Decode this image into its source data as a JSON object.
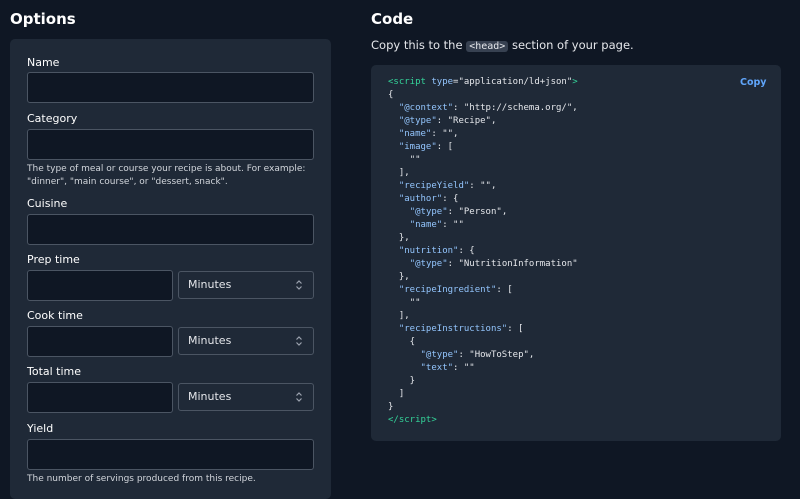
{
  "options": {
    "heading": "Options",
    "fields": {
      "name": {
        "label": "Name",
        "value": ""
      },
      "category": {
        "label": "Category",
        "value": "",
        "help_line1": "The type of meal or course your recipe is about. For example:",
        "help_line2": "\"dinner\", \"main course\", or \"dessert, snack\"."
      },
      "cuisine": {
        "label": "Cuisine",
        "value": ""
      },
      "prep_time": {
        "label": "Prep time",
        "value": "",
        "unit": "Minutes"
      },
      "cook_time": {
        "label": "Cook time",
        "value": "",
        "unit": "Minutes"
      },
      "total_time": {
        "label": "Total time",
        "value": "",
        "unit": "Minutes"
      },
      "yield": {
        "label": "Yield",
        "value": "",
        "help": "The number of servings produced from this recipe."
      }
    }
  },
  "code": {
    "heading": "Code",
    "instruction_before": "Copy this to the ",
    "instruction_tag": "<head>",
    "instruction_after": " section of your page.",
    "copy_label": "Copy",
    "lines": [
      [
        [
          "tag",
          "<script "
        ],
        [
          "attr",
          "type"
        ],
        [
          "punc",
          "="
        ],
        [
          "str",
          "\"application/ld+json\""
        ],
        [
          "tag",
          ">"
        ]
      ],
      [
        [
          "punc",
          "{"
        ]
      ],
      [
        [
          "punc",
          "  "
        ],
        [
          "key",
          "\"@context\""
        ],
        [
          "punc",
          ": "
        ],
        [
          "str",
          "\"http://schema.org/\""
        ],
        [
          "punc",
          ","
        ]
      ],
      [
        [
          "punc",
          "  "
        ],
        [
          "key",
          "\"@type\""
        ],
        [
          "punc",
          ": "
        ],
        [
          "str",
          "\"Recipe\""
        ],
        [
          "punc",
          ","
        ]
      ],
      [
        [
          "punc",
          "  "
        ],
        [
          "key",
          "\"name\""
        ],
        [
          "punc",
          ": "
        ],
        [
          "str",
          "\"\""
        ],
        [
          "punc",
          ","
        ]
      ],
      [
        [
          "punc",
          "  "
        ],
        [
          "key",
          "\"image\""
        ],
        [
          "punc",
          ": ["
        ]
      ],
      [
        [
          "punc",
          "    "
        ],
        [
          "str",
          "\"\""
        ]
      ],
      [
        [
          "punc",
          "  ],"
        ]
      ],
      [
        [
          "punc",
          "  "
        ],
        [
          "key",
          "\"recipeYield\""
        ],
        [
          "punc",
          ": "
        ],
        [
          "str",
          "\"\""
        ],
        [
          "punc",
          ","
        ]
      ],
      [
        [
          "punc",
          "  "
        ],
        [
          "key",
          "\"author\""
        ],
        [
          "punc",
          ": {"
        ]
      ],
      [
        [
          "punc",
          "    "
        ],
        [
          "key",
          "\"@type\""
        ],
        [
          "punc",
          ": "
        ],
        [
          "str",
          "\"Person\""
        ],
        [
          "punc",
          ","
        ]
      ],
      [
        [
          "punc",
          "    "
        ],
        [
          "key",
          "\"name\""
        ],
        [
          "punc",
          ": "
        ],
        [
          "str",
          "\"\""
        ]
      ],
      [
        [
          "punc",
          "  },"
        ]
      ],
      [
        [
          "punc",
          "  "
        ],
        [
          "key",
          "\"nutrition\""
        ],
        [
          "punc",
          ": {"
        ]
      ],
      [
        [
          "punc",
          "    "
        ],
        [
          "key",
          "\"@type\""
        ],
        [
          "punc",
          ": "
        ],
        [
          "str",
          "\"NutritionInformation\""
        ]
      ],
      [
        [
          "punc",
          "  },"
        ]
      ],
      [
        [
          "punc",
          "  "
        ],
        [
          "key",
          "\"recipeIngredient\""
        ],
        [
          "punc",
          ": ["
        ]
      ],
      [
        [
          "punc",
          "    "
        ],
        [
          "str",
          "\"\""
        ]
      ],
      [
        [
          "punc",
          "  ],"
        ]
      ],
      [
        [
          "punc",
          "  "
        ],
        [
          "key",
          "\"recipeInstructions\""
        ],
        [
          "punc",
          ": ["
        ]
      ],
      [
        [
          "punc",
          "    {"
        ]
      ],
      [
        [
          "punc",
          "      "
        ],
        [
          "key",
          "\"@type\""
        ],
        [
          "punc",
          ": "
        ],
        [
          "str",
          "\"HowToStep\""
        ],
        [
          "punc",
          ","
        ]
      ],
      [
        [
          "punc",
          "      "
        ],
        [
          "key",
          "\"text\""
        ],
        [
          "punc",
          ": "
        ],
        [
          "str",
          "\"\""
        ]
      ],
      [
        [
          "punc",
          "    }"
        ]
      ],
      [
        [
          "punc",
          "  ]"
        ]
      ],
      [
        [
          "punc",
          "}"
        ]
      ],
      [
        [
          "tag",
          "</script"
        ],
        [
          "tag",
          ">"
        ]
      ]
    ]
  },
  "colors": {
    "page_bg": "#0f1724",
    "panel_bg": "#1f2937",
    "accent": "#60a5fa",
    "tag_green": "#34d399",
    "key_blue": "#93c5fd"
  },
  "icons": {
    "select_arrows": "updown-chevrons-icon"
  }
}
